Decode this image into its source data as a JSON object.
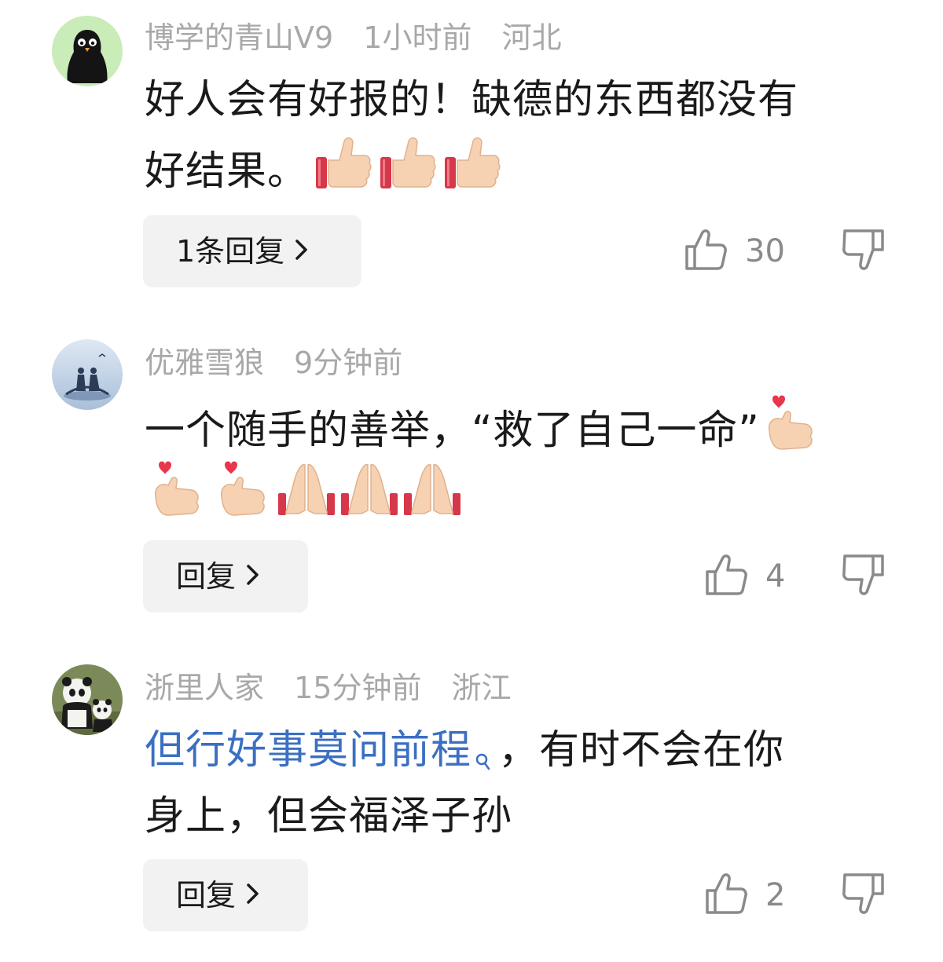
{
  "comments": [
    {
      "username": "博学的青山V9",
      "time": "1小时前",
      "location": "河北",
      "line1": "好人会有好报的！缺德的东西都没有",
      "line2": "好结果。",
      "reply_label": "1条回复",
      "likes": "30",
      "avatar": "bird-avatar-icon"
    },
    {
      "username": "优雅雪狼",
      "time": "9分钟前",
      "location": "",
      "line1": "一个随手的善举，“救了自己一命”",
      "line2": "",
      "reply_label": "回复",
      "likes": "4",
      "avatar": "couple-bridge-avatar-icon"
    },
    {
      "username": "浙里人家",
      "time": "15分钟前",
      "location": "浙江",
      "line1_link": "但行好事莫问前程",
      "line1_rest": "，有时不会在你",
      "line2": "身上，但会福泽子孙",
      "reply_label": "回复",
      "likes": "2",
      "avatar": "panda-avatar-icon"
    }
  ],
  "icons": {
    "like": "thumbs-up-outline-icon",
    "dislike": "thumbs-down-outline-icon",
    "chevron": "chevron-right-icon",
    "search": "search-icon"
  },
  "colors": {
    "meta": "#a8a8a8",
    "link": "#3b6fc2",
    "reply_bg": "#f2f2f2",
    "count": "#8a8a8a"
  }
}
